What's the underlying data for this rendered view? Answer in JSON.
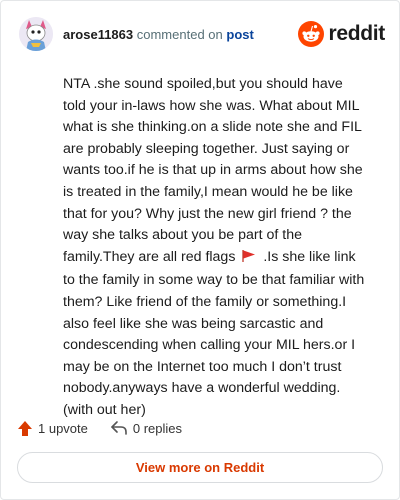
{
  "header": {
    "username": "arose11863",
    "action_text": "commented on",
    "post_link": "post",
    "brand": "reddit"
  },
  "comment": {
    "before_flag": "NTA .she sound spoiled,but you should have told your in-laws how she was. What about MIL what is she thinking.on a slide note she and FIL are probably sleeping together. Just saying or wants too.if he is that up in arms about how she is treated in the family,I mean would he be like that for you? Why just the new girl friend ? the way she talks about you be part of the family.They are all red flags",
    "after_flag": " .Is she like link to the family in some way to be that familiar with them? Like friend of the family or something.I also feel like she was being sarcastic and condescending when calling your MIL hers.or I may be on the Internet too much I don’t trust nobody.anyways have a wonderful wedding.(with out her)"
  },
  "footer": {
    "upvotes": "1 upvote",
    "replies": "0 replies"
  },
  "view_more": "View more on Reddit",
  "colors": {
    "brand_orange": "#ff4500",
    "upvote": "#d93a00",
    "link_blue": "#0a449b",
    "view_more": "#d93900"
  }
}
